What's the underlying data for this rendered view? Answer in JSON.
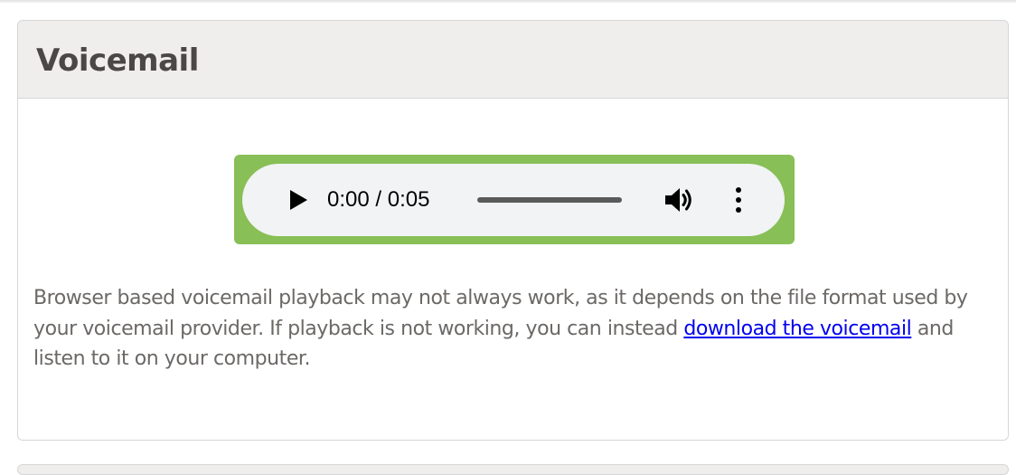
{
  "panel": {
    "title": "Voicemail"
  },
  "player": {
    "current_time": "0:00",
    "separator": " / ",
    "duration": "0:05",
    "progress": 0.0,
    "volume_level": 1.0,
    "frame_color": "#88bf56",
    "controls_color": "#f1f3f4",
    "play_icon": "play-icon",
    "volume_icon": "volume-icon",
    "more_icon": "more-options-icon"
  },
  "notice": {
    "text_before": "Browser based voicemail playback may not always work, as it depends on the file format used by your voicemail provider. If playback is not working, you can instead ",
    "link_text": "download the voicemail",
    "text_after": " and listen to it on your computer."
  }
}
